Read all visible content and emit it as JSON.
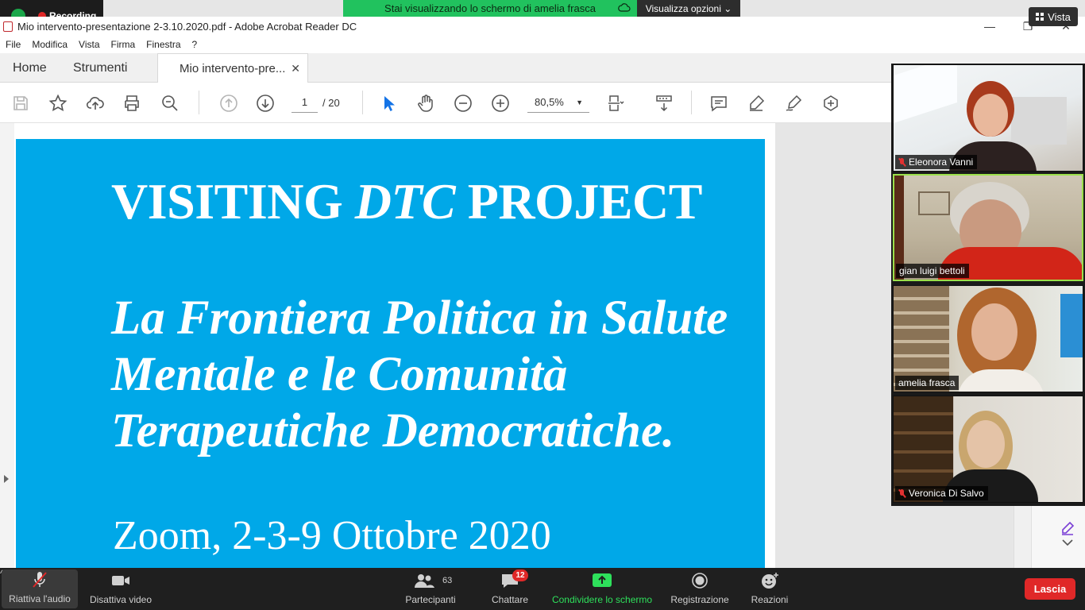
{
  "recording": {
    "label": "Recording"
  },
  "share_banner": {
    "text": "Stai visualizzando lo schermo di amelia frasca",
    "options_label": "Visualizza opzioni ⌄"
  },
  "view_button": {
    "label": "Vista"
  },
  "window": {
    "title": "Mio intervento-presentazione 2-3.10.2020.pdf - Adobe Acrobat Reader DC",
    "controls": [
      "—",
      "❐",
      "✕"
    ]
  },
  "menu": [
    "File",
    "Modifica",
    "Vista",
    "Firma",
    "Finestra",
    "?"
  ],
  "tabs": {
    "home": "Home",
    "tools": "Strumenti",
    "doc": "Mio intervento-pre...",
    "close": "✕"
  },
  "toolbar": {
    "page_current": "1",
    "page_total": "/   20",
    "zoom": "80,5%",
    "zoom_caret": "▼"
  },
  "slide": {
    "title_pre": "VISITING ",
    "title_italic": "DTC",
    "title_post": " PROJECT",
    "subtitle": "La Frontiera Politica in Salute Mentale e le Comunità Terapeutiche Democratiche.",
    "date": "Zoom, 2-3-9 Ottobre 2020"
  },
  "participants_video": [
    {
      "name": "Eleonora Vanni",
      "muted": true
    },
    {
      "name": "gian luigi bettoli",
      "muted": false
    },
    {
      "name": "amelia frasca",
      "muted": false
    },
    {
      "name": "Veronica Di Salvo",
      "muted": true
    }
  ],
  "zoom_bar": {
    "audio": "Riattiva l'audio",
    "video": "Disattiva video",
    "participants": "Partecipanti",
    "participants_count": "63",
    "chat": "Chattare",
    "chat_badge": "12",
    "share": "Condividere lo schermo",
    "record": "Registrazione",
    "reactions": "Reazioni",
    "leave": "Lascia",
    "chevron": "^"
  },
  "colors": {
    "slide_bg": "#00a8e8",
    "share_green": "#21c25e",
    "leave_red": "#e02828",
    "active_speaker": "#9be04b"
  }
}
